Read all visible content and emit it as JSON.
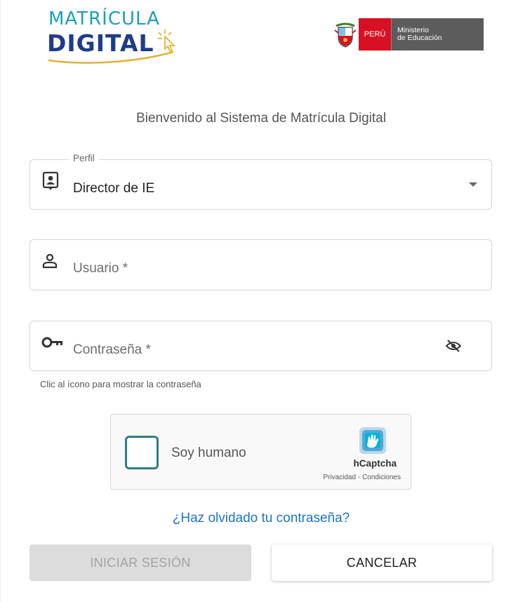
{
  "brand": {
    "logo_line1": "MATRÍCULA",
    "logo_line2": "DIGITAL",
    "country": "PERÚ",
    "ministry_line1": "Ministerio",
    "ministry_line2": "de Educación",
    "colors": {
      "teal": "#1aa0b8",
      "navy": "#1f3c88",
      "gold": "#e2b233",
      "peru_red": "#d91023",
      "ministry_gray": "#5c5c5c"
    }
  },
  "welcome": "Bienvenido al Sistema de Matrícula Digital",
  "form": {
    "perfil": {
      "label": "Perfil",
      "value": "Director de IE",
      "icon": "id-badge-icon"
    },
    "usuario": {
      "placeholder": "Usuario *",
      "icon": "person-icon"
    },
    "password": {
      "placeholder": "Contraseña *",
      "icon": "key-icon",
      "toggle_icon": "eye-off-icon"
    },
    "password_hint": "Clic al ícono para mostrar la contraseña"
  },
  "captcha": {
    "label": "Soy humano",
    "brand": "hCaptcha",
    "privacy": "Privacidad",
    "separator": " - ",
    "terms": "Condiciones"
  },
  "forgot_link": "¿Haz olvidado tu contraseña?",
  "buttons": {
    "login": "INICIAR SESIÓN",
    "cancel": "CANCELAR"
  }
}
